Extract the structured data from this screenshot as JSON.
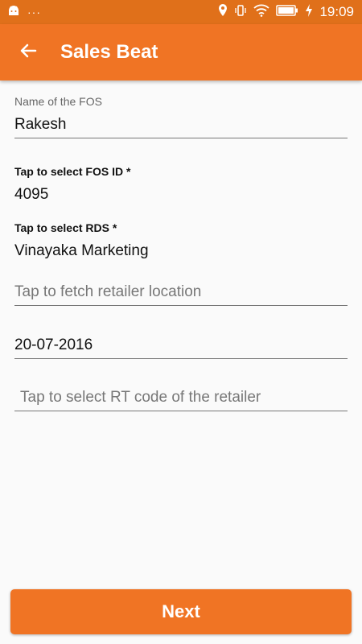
{
  "status_bar": {
    "time": "19:09"
  },
  "app_bar": {
    "title": "Sales Beat"
  },
  "form": {
    "fos_name": {
      "label": "Name of the FOS",
      "value": "Rakesh"
    },
    "fos_id": {
      "label": "Tap to select FOS ID *",
      "value": "4095"
    },
    "rds": {
      "label": "Tap to select RDS *",
      "value": "Vinayaka Marketing"
    },
    "retailer_location": {
      "placeholder": "Tap to fetch retailer location"
    },
    "date": {
      "value": "20-07-2016"
    },
    "rt_code": {
      "placeholder": "Tap to select RT code of the retailer"
    }
  },
  "next_button": {
    "label": "Next"
  },
  "colors": {
    "primary": "#f07424",
    "status_bar": "#e0701a"
  }
}
